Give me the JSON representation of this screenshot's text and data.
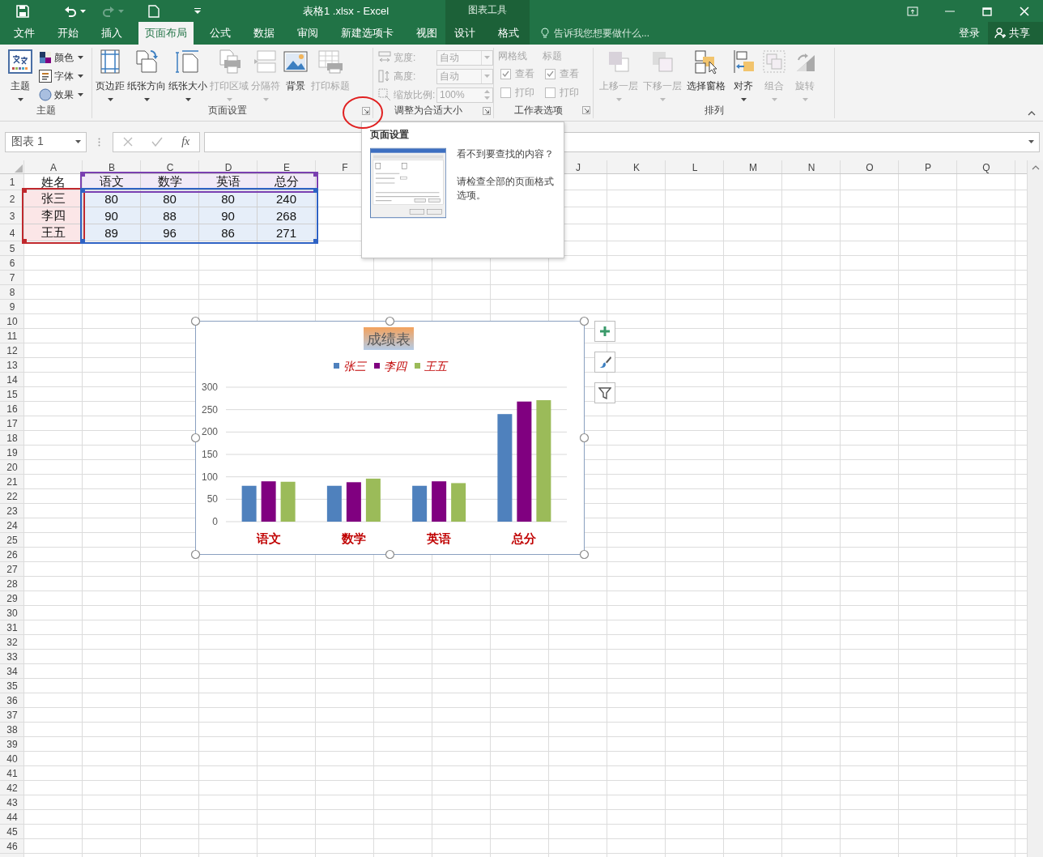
{
  "title_bar": {
    "title": "表格1 .xlsx - Excel",
    "context_label": "图表工具"
  },
  "tabs": [
    {
      "label": "文件",
      "selected": false
    },
    {
      "label": "开始",
      "selected": false
    },
    {
      "label": "插入",
      "selected": false
    },
    {
      "label": "页面布局",
      "selected": true
    },
    {
      "label": "公式",
      "selected": false
    },
    {
      "label": "数据",
      "selected": false
    },
    {
      "label": "审阅",
      "selected": false
    },
    {
      "label": "新建选项卡",
      "selected": false
    },
    {
      "label": "视图",
      "selected": false
    }
  ],
  "context_tabs": [
    {
      "label": "设计",
      "selected": false
    },
    {
      "label": "格式",
      "selected": false
    }
  ],
  "tell_me": {
    "placeholder": "告诉我您想要做什么..."
  },
  "account": {
    "sign_in": "登录",
    "share": "共享"
  },
  "ribbon": {
    "groups": [
      {
        "label": "主题",
        "launcher": false,
        "items": [
          {
            "kind": "large",
            "label": "主题",
            "dropdown": true,
            "disabled": false
          },
          {
            "kind": "stack",
            "buttons": [
              {
                "label": "颜色",
                "dropdown": true
              },
              {
                "label": "字体",
                "dropdown": true
              },
              {
                "label": "效果",
                "dropdown": true
              }
            ]
          }
        ]
      },
      {
        "label": "页面设置",
        "launcher": true,
        "items": [
          {
            "kind": "large",
            "label": "页边距",
            "dropdown": true,
            "disabled": false
          },
          {
            "kind": "large",
            "label": "纸张方向",
            "dropdown": true,
            "disabled": false
          },
          {
            "kind": "large",
            "label": "纸张大小",
            "dropdown": true,
            "disabled": false
          },
          {
            "kind": "large",
            "label": "打印区域",
            "dropdown": true,
            "disabled": true
          },
          {
            "kind": "large",
            "label": "分隔符",
            "dropdown": true,
            "disabled": true
          },
          {
            "kind": "large",
            "label": "背景",
            "dropdown": false,
            "disabled": false
          },
          {
            "kind": "large",
            "label": "打印标题",
            "dropdown": false,
            "disabled": true
          }
        ]
      },
      {
        "label": "调整为合适大小",
        "launcher": true,
        "items": [
          {
            "kind": "fields",
            "disabled": true,
            "rows": [
              {
                "label": "宽度:",
                "value": "自动",
                "kind": "dropdown"
              },
              {
                "label": "高度:",
                "value": "自动",
                "kind": "dropdown"
              },
              {
                "label": "缩放比例:",
                "value": "100%",
                "kind": "spinner"
              }
            ]
          }
        ]
      },
      {
        "label": "工作表选项",
        "launcher": true,
        "items": [
          {
            "kind": "checks",
            "heading": "网格线",
            "disabled": true,
            "options": [
              {
                "label": "查看",
                "checked": true
              },
              {
                "label": "打印",
                "checked": false
              }
            ]
          },
          {
            "kind": "checks",
            "heading": "标题",
            "disabled": true,
            "options": [
              {
                "label": "查看",
                "checked": true
              },
              {
                "label": "打印",
                "checked": false
              }
            ]
          }
        ]
      },
      {
        "label": "排列",
        "launcher": false,
        "items": [
          {
            "kind": "large",
            "label": "上移一层",
            "dropdown": true,
            "disabled": true
          },
          {
            "kind": "large",
            "label": "下移一层",
            "dropdown": true,
            "disabled": true
          },
          {
            "kind": "large",
            "label": "选择窗格",
            "dropdown": false,
            "disabled": false
          },
          {
            "kind": "large",
            "label": "对齐",
            "dropdown": true,
            "disabled": false
          },
          {
            "kind": "large",
            "label": "组合",
            "dropdown": true,
            "disabled": true
          },
          {
            "kind": "large",
            "label": "旋转",
            "dropdown": true,
            "disabled": true
          }
        ]
      }
    ]
  },
  "formula_bar": {
    "name_box": "图表 1",
    "function_label": "fx"
  },
  "sheet": {
    "columns_left": [
      "A",
      "B",
      "C",
      "D",
      "E",
      "F"
    ],
    "columns_right": [
      "J",
      "K",
      "L",
      "M",
      "N",
      "O",
      "P",
      "Q"
    ],
    "row_numbers": [
      "1",
      "2",
      "3",
      "4",
      "5",
      "6",
      "7",
      "8",
      "9",
      "10",
      "11",
      "12",
      "13",
      "14",
      "15",
      "16",
      "17",
      "18",
      "19",
      "20",
      "21",
      "22",
      "23",
      "24",
      "25",
      "26",
      "27",
      "28",
      "29",
      "30",
      "31",
      "32",
      "33",
      "34",
      "35",
      "36",
      "37",
      "38",
      "39",
      "40",
      "41",
      "42",
      "43",
      "44",
      "45",
      "46"
    ],
    "show_chart_ranges": true,
    "cells": [
      [
        "姓名",
        "语文",
        "数学",
        "英语",
        "总分"
      ],
      [
        "张三",
        "80",
        "80",
        "80",
        "240"
      ],
      [
        "李四",
        "90",
        "88",
        "90",
        "268"
      ],
      [
        "王五",
        "89",
        "96",
        "86",
        "271"
      ]
    ]
  },
  "chart": {
    "selected": true,
    "chart_data": {
      "type": "bar",
      "title": "成绩表",
      "categories": [
        "语文",
        "数学",
        "英语",
        "总分"
      ],
      "series": [
        {
          "name": "张三",
          "color": "#4f81bd",
          "values": [
            80,
            80,
            80,
            240
          ]
        },
        {
          "name": "李四",
          "color": "#800080",
          "values": [
            90,
            88,
            90,
            268
          ]
        },
        {
          "name": "王五",
          "color": "#9bbb59",
          "values": [
            89,
            96,
            86,
            271
          ]
        }
      ],
      "ylim": [
        0,
        300
      ],
      "yticks": [
        0,
        50,
        100,
        150,
        200,
        250,
        300
      ],
      "grid": true,
      "legend": true
    }
  },
  "tooltip": {
    "title": "页面设置",
    "lines": [
      "看不到要查找的内容？",
      "请检查全部的页面格式选项。"
    ]
  }
}
